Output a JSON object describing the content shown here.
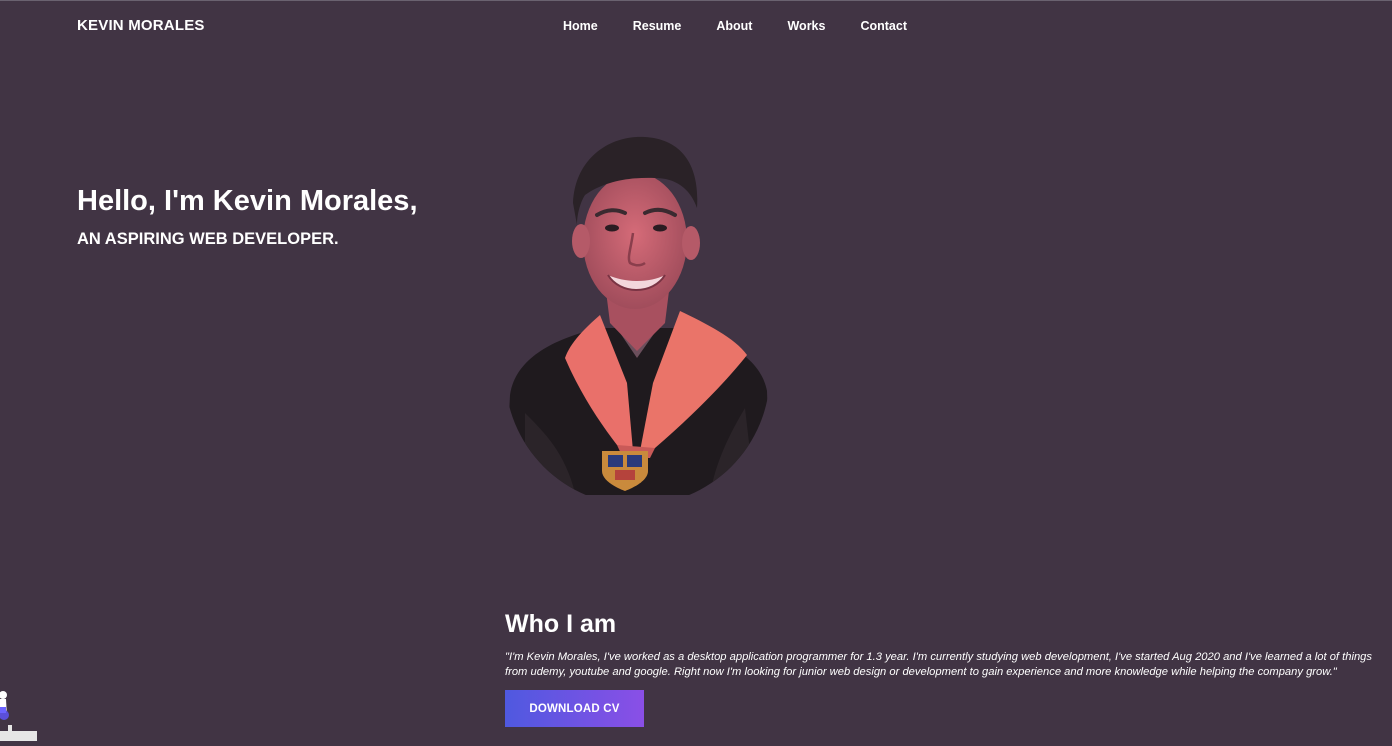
{
  "header": {
    "brand": "KEVIN MORALES",
    "nav": [
      "Home",
      "Resume",
      "About",
      "Works",
      "Contact"
    ]
  },
  "hero": {
    "title": "Hello, I'm Kevin Morales,",
    "subtitle": "AN ASPIRING WEB DEVELOPER."
  },
  "about": {
    "heading": "Who I am",
    "line1": "\"I'm Kevin Morales, I've worked as a desktop application programmer for 1.3 year. I'm currently studying web development, I've started Aug 2020 and I've learned a lot of things",
    "line2": "from udemy, youtube and google. Right now I'm looking for junior web design or development to gain experience and more knowledge while helping the company grow.\"",
    "download_label": "DOWNLOAD CV"
  },
  "colors": {
    "background": "#413444",
    "button_start": "#4f59e0",
    "button_end": "#8a4fe6",
    "sash": "#e9706a"
  },
  "icons": {
    "portrait": "graduate-portrait-photo",
    "corner": "person-illustration"
  }
}
